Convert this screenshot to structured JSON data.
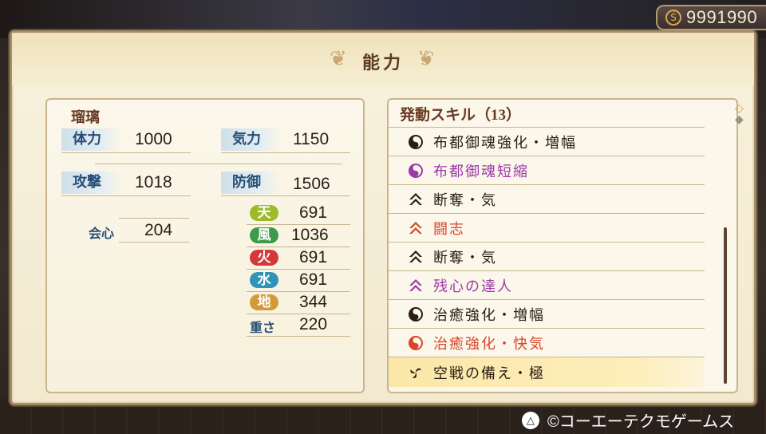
{
  "gold": {
    "value": "9991990",
    "icon": "coin-icon"
  },
  "header": {
    "title": "能力"
  },
  "character": {
    "name": "瑠璃"
  },
  "stats": {
    "hp_label": "体力",
    "hp": "1000",
    "ki_label": "気力",
    "ki": "1150",
    "atk_label": "攻撃",
    "atk": "1018",
    "def_label": "防御",
    "def": "1506",
    "crit_label": "会心",
    "crit": "204",
    "weight_label": "重さ",
    "weight": "220"
  },
  "elements": [
    {
      "label": "天",
      "value": "691",
      "color": "#9bbb2a"
    },
    {
      "label": "風",
      "value": "1036",
      "color": "#3c9b4a"
    },
    {
      "label": "火",
      "value": "691",
      "color": "#d23a3a"
    },
    {
      "label": "水",
      "value": "691",
      "color": "#2f95b8"
    },
    {
      "label": "地",
      "value": "344",
      "color": "#d29a3a"
    }
  ],
  "skills": {
    "header": "発動スキル",
    "count": "（13）",
    "items": [
      {
        "label": "布都御魂強化・増幅",
        "icon": "black-swirl-icon",
        "color": "#2a1d14"
      },
      {
        "label": "布都御魂短縮",
        "icon": "purple-swirl-icon",
        "color": "#9a3aa8"
      },
      {
        "label": "断奪・気",
        "icon": "black-arrow-icon",
        "color": "#2a1d14"
      },
      {
        "label": "闘志",
        "icon": "red-arrow-icon",
        "color": "#d8452a"
      },
      {
        "label": "断奪・気",
        "icon": "black-arrow-icon",
        "color": "#2a1d14"
      },
      {
        "label": "残心の達人",
        "icon": "purple-arrow-icon",
        "color": "#9a3aa8"
      },
      {
        "label": "治癒強化・増幅",
        "icon": "black-swirl-icon",
        "color": "#2a1d14"
      },
      {
        "label": "治癒強化・快気",
        "icon": "red-swirl-icon",
        "color": "#d8452a"
      },
      {
        "label": "空戦の備え・極",
        "icon": "triskelion-icon",
        "color": "#2a1d14"
      }
    ]
  },
  "footer": {
    "button": "△",
    "copyright": "©コーエーテクモゲームス"
  }
}
